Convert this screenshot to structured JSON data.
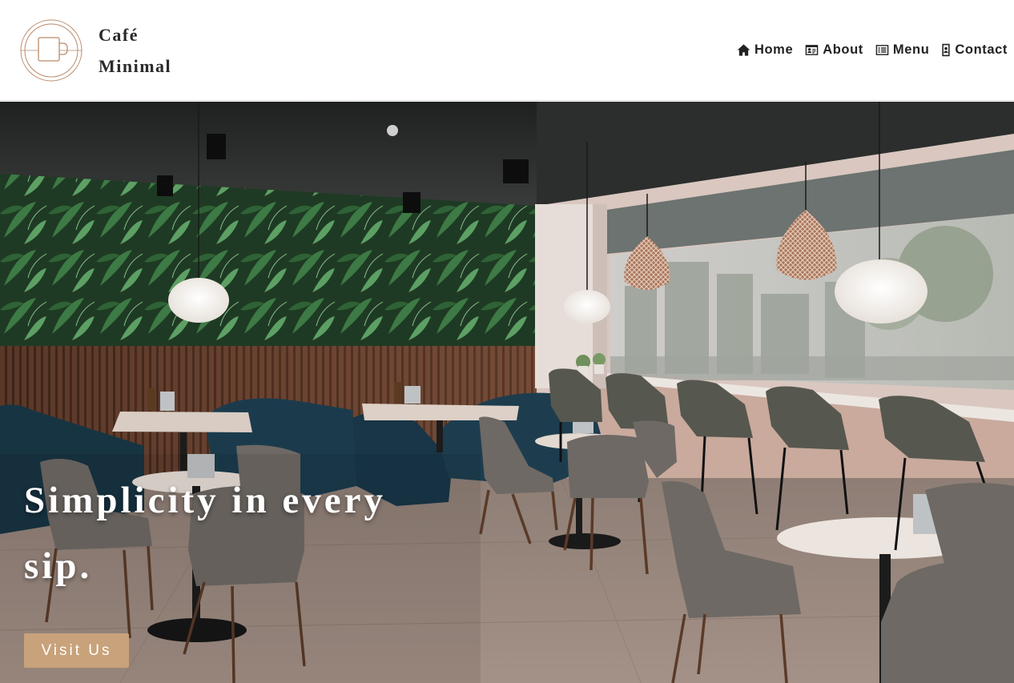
{
  "brand": {
    "line1": "Café",
    "line2": "Minimal",
    "logo_icon": "coffee-cup-icon"
  },
  "nav": {
    "items": [
      {
        "label": "Home",
        "icon": "home-icon"
      },
      {
        "label": "About",
        "icon": "id-card-icon"
      },
      {
        "label": "Menu",
        "icon": "list-icon"
      },
      {
        "label": "Contact",
        "icon": "contact-book-icon"
      }
    ]
  },
  "hero": {
    "headline": "Simplicity in every sip.",
    "cta_label": "Visit Us"
  },
  "colors": {
    "accent": "#c8a27a",
    "text_dark": "#222222",
    "logo_stroke": "#b98a6a"
  }
}
